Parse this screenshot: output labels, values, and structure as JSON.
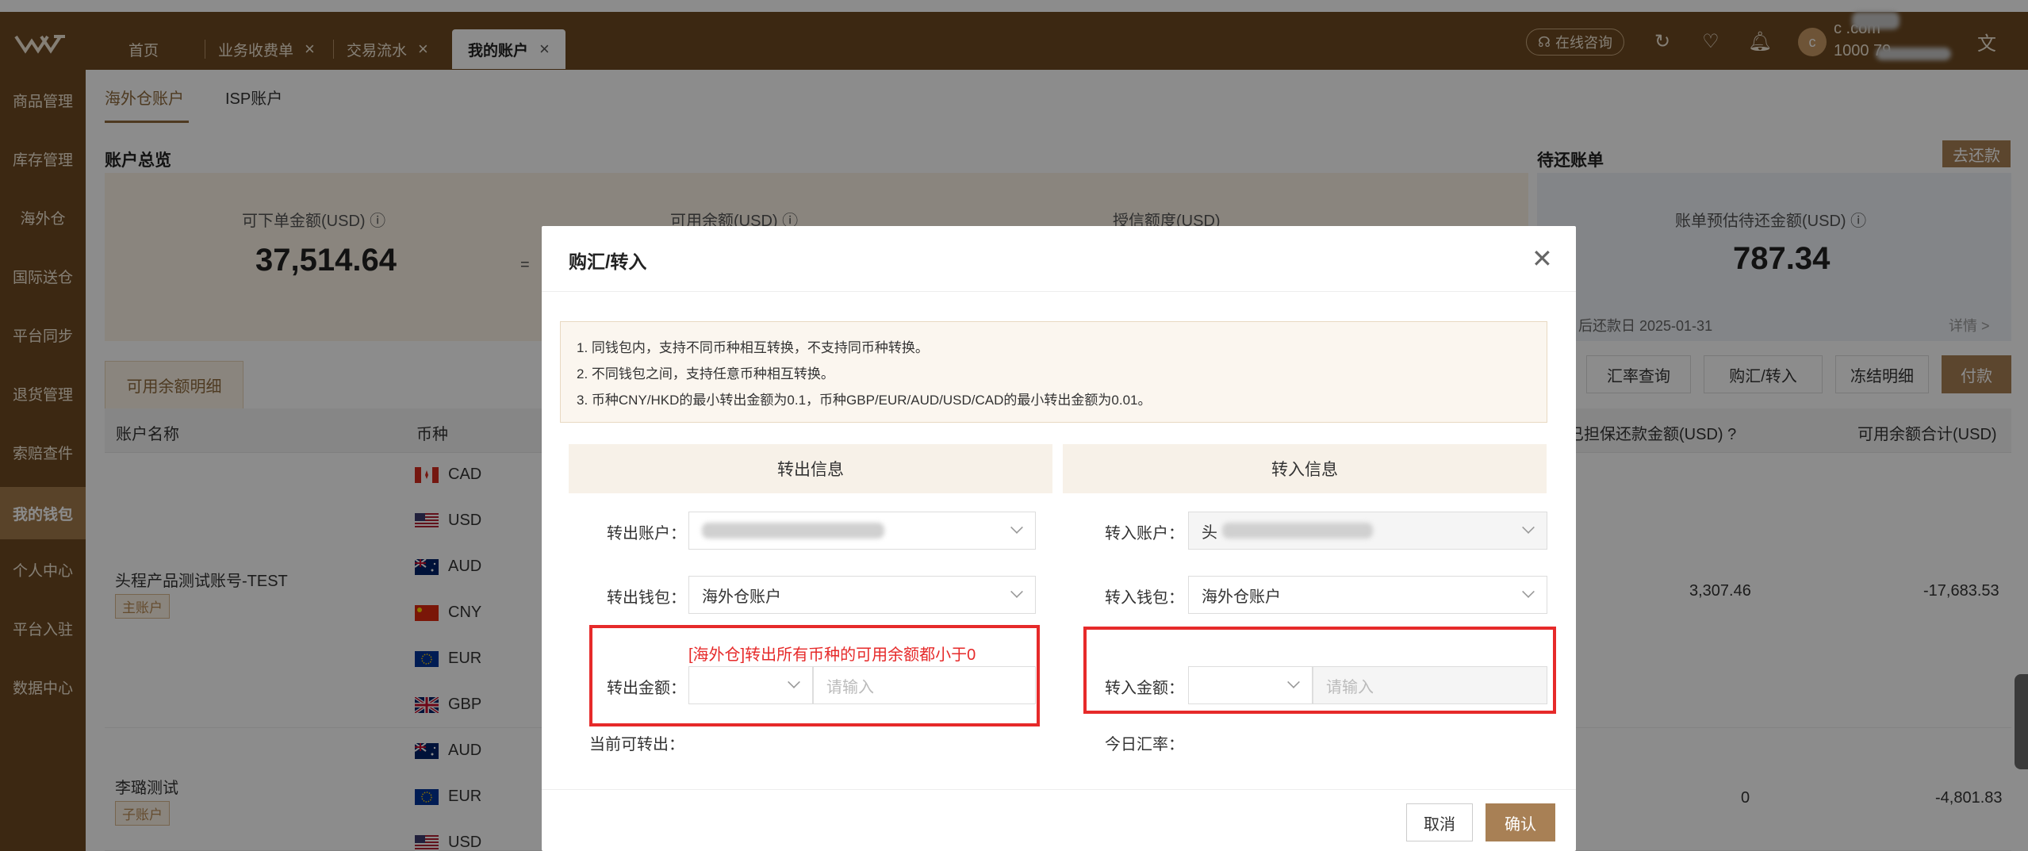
{
  "header": {
    "tabs": [
      {
        "label": "首页",
        "closable": false
      },
      {
        "label": "业务收费单",
        "closable": true
      },
      {
        "label": "交易流水",
        "closable": true
      },
      {
        "label": "我的账户",
        "closable": true,
        "active": true
      }
    ],
    "consult_label": "在线咨询",
    "user_avatar_letter": "c",
    "user_email": "c .com",
    "user_id": "1000 79",
    "icons": [
      "refresh-icon",
      "favorite-icon",
      "bell-icon",
      "translate-icon"
    ]
  },
  "sidebar": {
    "items": [
      {
        "label": "商品管理"
      },
      {
        "label": "库存管理"
      },
      {
        "label": "海外仓"
      },
      {
        "label": "国际送仓"
      },
      {
        "label": "平台同步"
      },
      {
        "label": "退货管理"
      },
      {
        "label": "索赔查件"
      },
      {
        "label": "我的钱包",
        "active": true
      },
      {
        "label": "个人中心"
      },
      {
        "label": "平台入驻"
      },
      {
        "label": "数据中心"
      }
    ]
  },
  "subtabs": [
    "海外仓账户",
    "ISP账户"
  ],
  "overview": {
    "title": "账户总览",
    "orderable_label": "可下单金额(USD)",
    "orderable_value": "37,514.64",
    "equals": "=",
    "available_label": "可用余额(USD)",
    "credit_label": "授信额度(USD)"
  },
  "pending": {
    "title": "待还账单",
    "payoff_label": "去还款",
    "est_label": "账单预估待还金额(USD)",
    "est_value": "787.34",
    "due_date": "后还款日 2025-01-31",
    "detail_link": "详情 >"
  },
  "avail_tab": "可用余额明细",
  "actions": [
    "汇率查询",
    "购汇/转入",
    "冻结明细",
    "付款"
  ],
  "table": {
    "headers": [
      "账户名称",
      "币种",
      "已担保还款金额(USD)",
      "可用余额合计(USD)"
    ],
    "accounts": [
      {
        "name": "头程产品测试账号-TEST",
        "badge": "主账户",
        "guarantee": "3,307.46",
        "total": "-17,683.53",
        "currencies": [
          "CAD",
          "USD",
          "AUD",
          "CNY",
          "EUR",
          "GBP"
        ]
      },
      {
        "name": "李璐测试",
        "badge": "子账户",
        "guarantee": "0",
        "total": "-4,801.83",
        "currencies": [
          "AUD",
          "EUR",
          "USD"
        ]
      }
    ]
  },
  "modal": {
    "title": "购汇/转入",
    "notice": [
      "1. 同钱包内，支持不同币种相互转换，不支持同币种转换。",
      "2. 不同钱包之间，支持任意币种相互转换。",
      "3. 币种CNY/HKD的最小转出金额为0.1，币种GBP/EUR/AUD/USD/CAD的最小转出金额为0.01。"
    ],
    "out": {
      "head": "转出信息",
      "account_label": "转出账户：",
      "wallet_label": "转出钱包：",
      "wallet_value": "海外仓账户",
      "amount_label": "转出金额：",
      "amount_placeholder": "请输入",
      "error": "[海外仓]转出所有币种的可用余额都小于0",
      "available_label": "当前可转出："
    },
    "in": {
      "head": "转入信息",
      "account_label": "转入账户：",
      "account_prefix": "头",
      "wallet_label": "转入钱包：",
      "wallet_value": "海外仓账户",
      "amount_label": "转入金额：",
      "amount_placeholder": "请输入",
      "rate_label": "今日汇率："
    },
    "cancel_label": "取消",
    "ok_label": "确认"
  },
  "colors": {
    "brand": "#6e4a22",
    "accent": "#a88055",
    "error": "#e62a2a"
  }
}
